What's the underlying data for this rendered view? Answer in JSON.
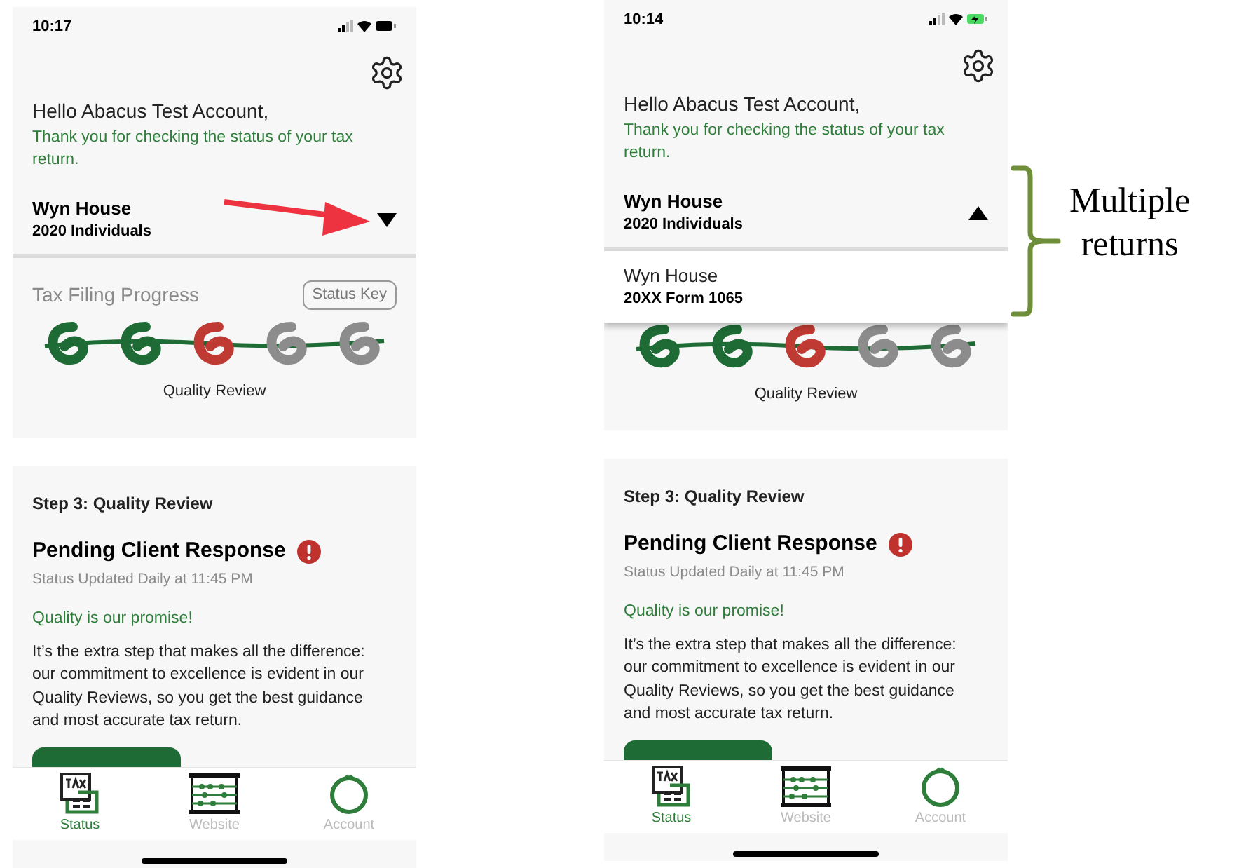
{
  "phones": [
    {
      "time": "10:17",
      "charging": false,
      "greeting": "Hello Abacus Test Account,",
      "thanks": "Thank you for checking the status of your tax return.",
      "selected_return": {
        "name": "Wyn House",
        "type": "2020 Individuals"
      },
      "expanded": false,
      "progress_title": "Tax Filing Progress",
      "status_key": "Status Key",
      "stages": [
        {
          "color": "#1e6b35"
        },
        {
          "color": "#1e6b35"
        },
        {
          "color": "#bf3a32"
        },
        {
          "color": "#8c8c8c"
        },
        {
          "color": "#8c8c8c"
        }
      ],
      "stage_label": "Quality Review",
      "step": "Step 3: Quality Review",
      "status_title": "Pending Client Response",
      "status_updated": "Status Updated Daily at 11:45 PM",
      "promise": "Quality is our promise!",
      "body": "It’s the extra step that makes all the difference: our commitment to excellence is evident in our Quality Reviews, so you get the best guidance and most accurate tax return.",
      "tabs": [
        {
          "label": "Status",
          "kind": "tax",
          "selected": true
        },
        {
          "label": "Website",
          "kind": "abacus",
          "selected": false
        },
        {
          "label": "Account",
          "kind": "account",
          "selected": false
        }
      ]
    },
    {
      "time": "10:14",
      "charging": true,
      "greeting": "Hello Abacus Test Account,",
      "thanks": "Thank you for checking the status of your tax return.",
      "selected_return": {
        "name": "Wyn House",
        "type": "2020 Individuals"
      },
      "expanded": true,
      "options": [
        {
          "name": "Wyn House",
          "type": "20XX Form 1065"
        }
      ],
      "stages": [
        {
          "color": "#1e6b35"
        },
        {
          "color": "#1e6b35"
        },
        {
          "color": "#bf3a32"
        },
        {
          "color": "#8c8c8c"
        },
        {
          "color": "#8c8c8c"
        }
      ],
      "stage_label": "Quality Review",
      "step": "Step 3: Quality Review",
      "status_title": "Pending Client Response",
      "status_updated": "Status Updated Daily at 11:45 PM",
      "promise": "Quality is our promise!",
      "body": "It’s the extra step that makes all the difference: our commitment to excellence is evident in our Quality Reviews, so you get the best guidance and most accurate tax return.",
      "tabs": [
        {
          "label": "Status",
          "kind": "tax",
          "selected": true
        },
        {
          "label": "Website",
          "kind": "abacus",
          "selected": false
        },
        {
          "label": "Account",
          "kind": "account",
          "selected": false
        }
      ]
    }
  ],
  "annotation": {
    "lines": [
      "Multiple",
      "returns"
    ]
  }
}
